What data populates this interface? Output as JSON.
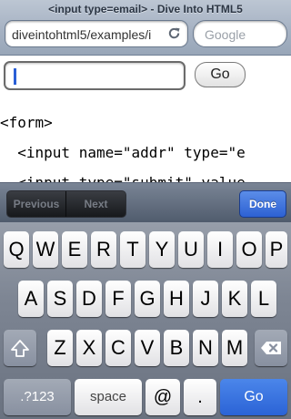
{
  "browser": {
    "page_title": "<input type=email> - Dive Into HTML5",
    "url": "diveintohtml5/examples/i",
    "search_placeholder": "Google"
  },
  "page": {
    "email_input_value": "",
    "go_label": "Go",
    "code_lines": [
      "<form>",
      "  <input name=\"addr\" type=\"e",
      "  <input type=\"submit\" value"
    ]
  },
  "form_assistant": {
    "previous_label": "Previous",
    "next_label": "Next",
    "done_label": "Done"
  },
  "keyboard": {
    "row1": [
      "Q",
      "W",
      "E",
      "R",
      "T",
      "Y",
      "U",
      "I",
      "O",
      "P"
    ],
    "row2": [
      "A",
      "S",
      "D",
      "F",
      "G",
      "H",
      "J",
      "K",
      "L"
    ],
    "row3": [
      "Z",
      "X",
      "C",
      "V",
      "B",
      "N",
      "M"
    ],
    "numbers_label": ".?123",
    "space_label": "space",
    "at_label": "@",
    "dot_label": ".",
    "go_label": "Go"
  }
}
